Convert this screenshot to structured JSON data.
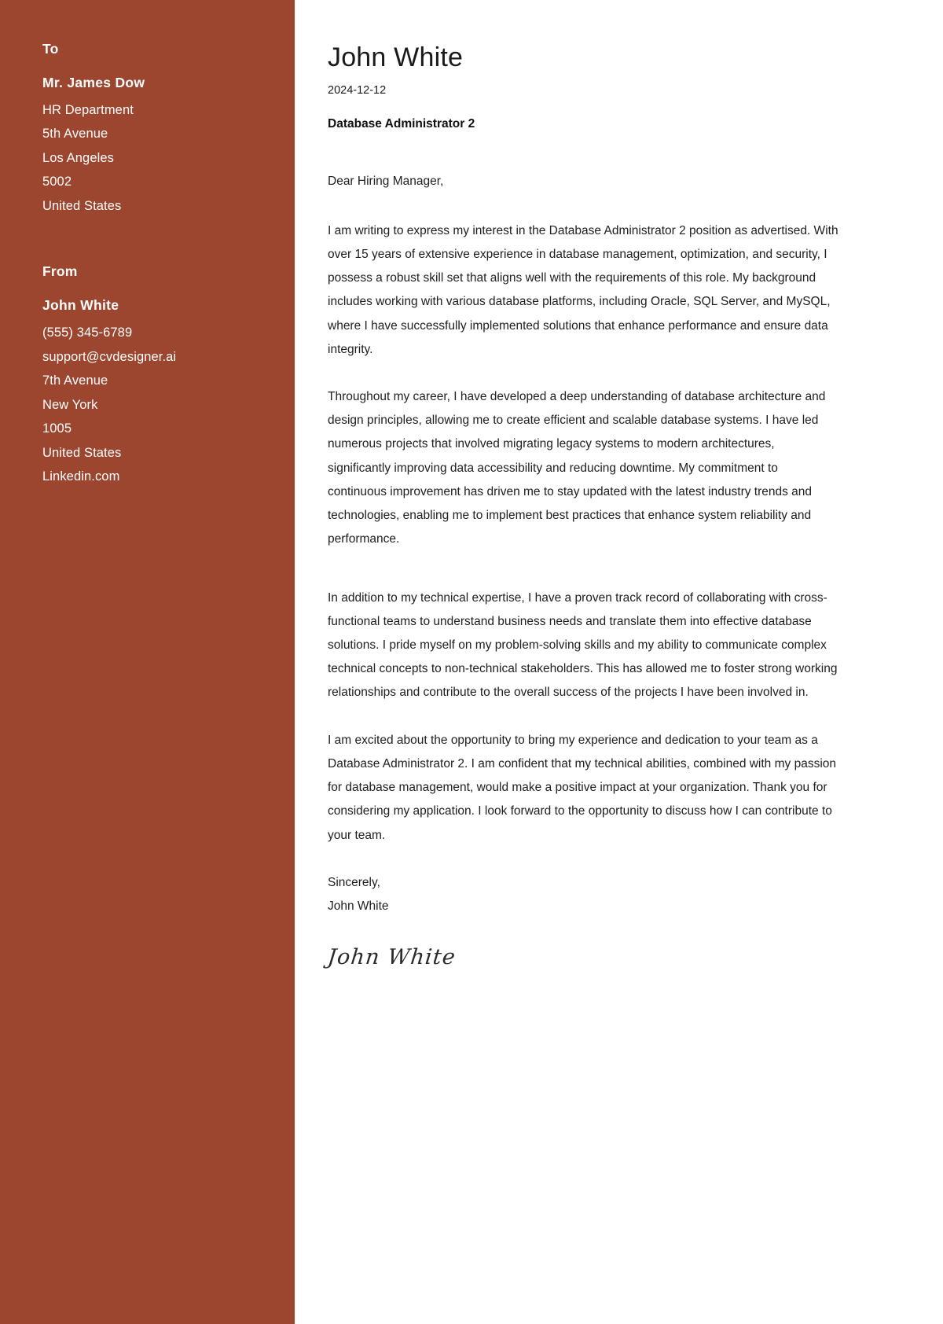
{
  "document": {
    "type": "cover-letter",
    "accent_color": "#9c452f",
    "sidebar_text_color": "#ffffff",
    "body_text_color": "#202020"
  },
  "sidebar": {
    "to": {
      "heading": "To",
      "name": "Mr. James Dow",
      "lines": [
        "HR Department",
        "5th Avenue",
        "Los Angeles",
        "5002",
        "United States"
      ]
    },
    "from": {
      "heading": "From",
      "name": "John White",
      "lines": [
        "(555) 345-6789",
        "support@cvdesigner.ai",
        "7th Avenue",
        "New York",
        "1005",
        "United States",
        "Linkedin.com"
      ]
    }
  },
  "letter": {
    "name": "John White",
    "date": "2024-12-12",
    "job_title": "Database Administrator 2",
    "salutation": "Dear Hiring Manager,",
    "paragraphs": [
      "I am writing to express my interest in the Database Administrator 2 position as advertised. With over 15 years of extensive experience in database management, optimization, and security, I possess a robust skill set that aligns well with the requirements of this role. My background includes working with various database platforms, including Oracle, SQL Server, and MySQL, where I have successfully implemented solutions that enhance performance and ensure data integrity.",
      "Throughout my career, I have developed a deep understanding of database architecture and design principles, allowing me to create efficient and scalable database systems. I have led numerous projects that involved migrating legacy systems to modern architectures, significantly improving data accessibility and reducing downtime. My commitment to continuous improvement has driven me to stay updated with the latest industry trends and technologies, enabling me to implement best practices that enhance system reliability and performance.",
      "In addition to my technical expertise, I have a proven track record of collaborating with cross-functional teams to understand business needs and translate them into effective database solutions. I pride myself on my problem-solving skills and my ability to communicate complex technical concepts to non-technical stakeholders. This has allowed me to foster strong working relationships and contribute to the overall success of the projects I have been involved in.",
      "I am excited about the opportunity to bring my experience and dedication to your team as a Database Administrator 2. I am confident that my technical abilities, combined with my passion for database management, would make a positive impact at your organization. Thank you for considering my application. I look forward to the opportunity to discuss how I can contribute to your team."
    ],
    "closing_word": "Sincerely,",
    "closing_name": "John White",
    "signature": "John White"
  }
}
